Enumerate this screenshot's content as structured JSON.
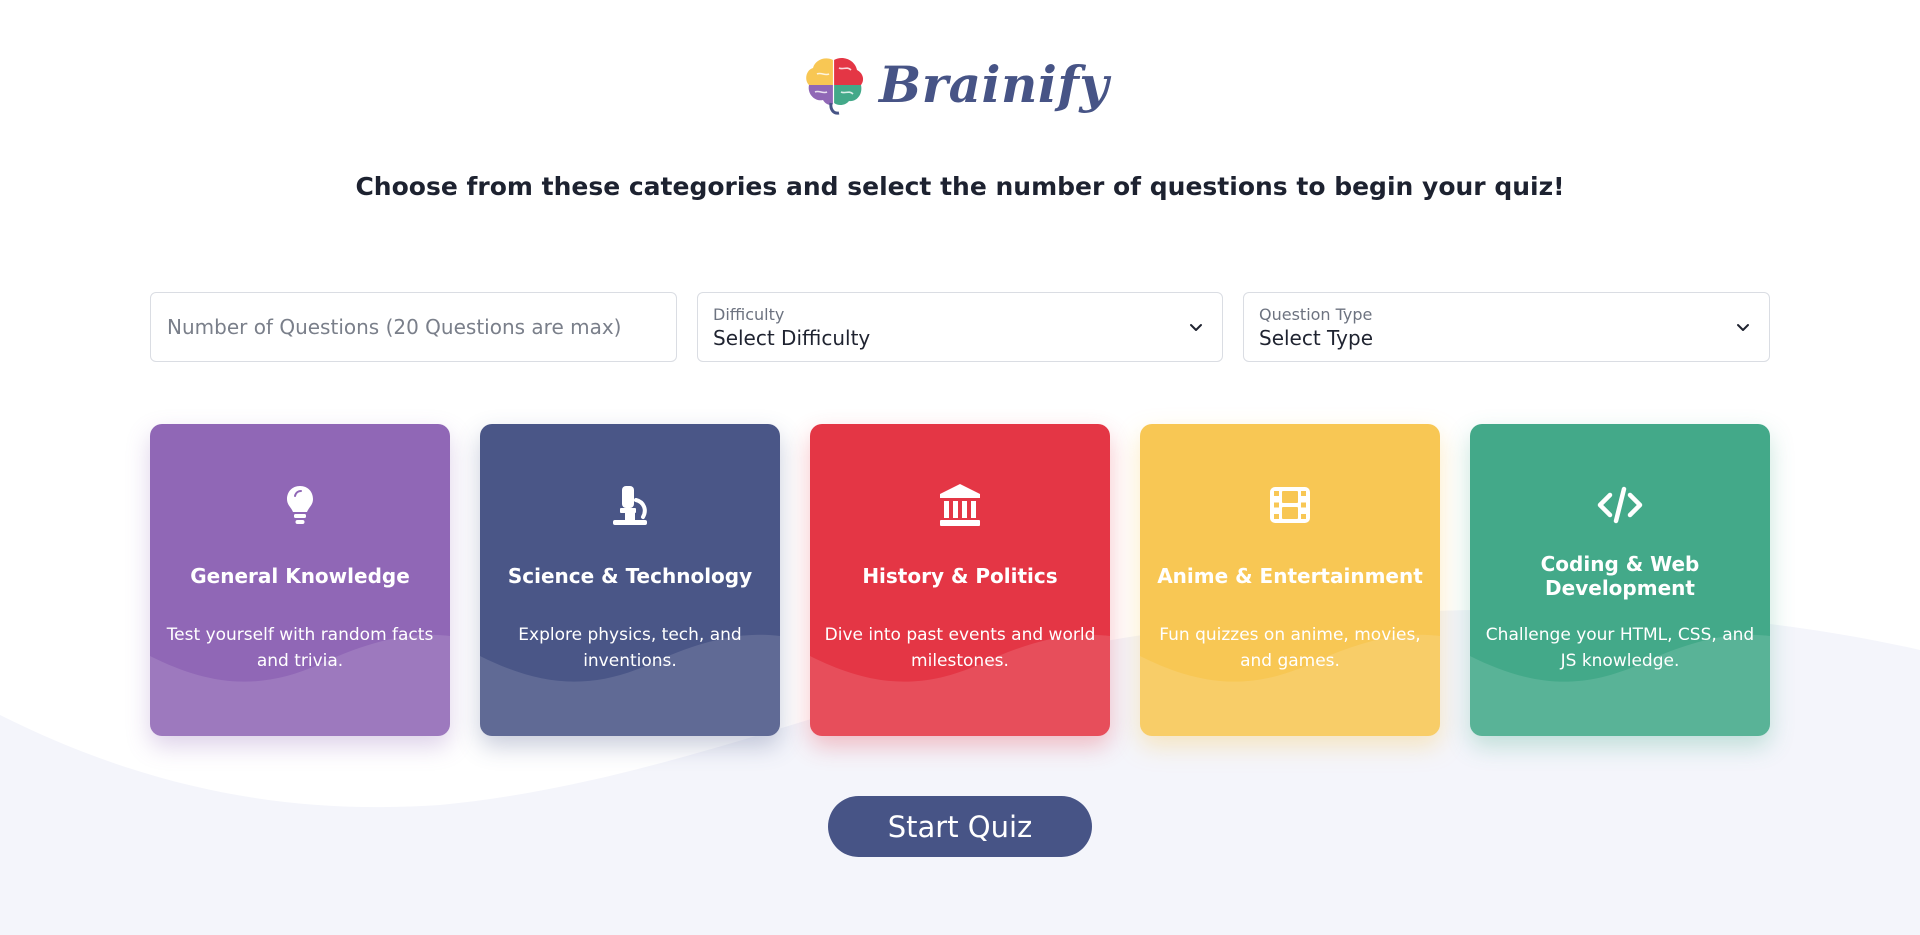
{
  "brand": {
    "name": "Brainify",
    "color": "#475486",
    "logo_icon": "brain-icon"
  },
  "subtitle": "Choose from these categories and select the number of questions to begin your quiz!",
  "form": {
    "num_questions": {
      "placeholder": "Number of Questions (20 Questions are max)",
      "value": ""
    },
    "difficulty": {
      "label": "Difficulty",
      "value": "Select Difficulty",
      "icon": "chevron-down-icon"
    },
    "question_type": {
      "label": "Question Type",
      "value": "Select Type",
      "icon": "chevron-down-icon"
    }
  },
  "categories": [
    {
      "title": "General Knowledge",
      "description": "Test yourself with random facts and trivia.",
      "icon": "lightbulb-icon",
      "color": "#9067b6"
    },
    {
      "title": "Science & Technology",
      "description": "Explore physics, tech, and inventions.",
      "icon": "microscope-icon",
      "color": "#4a5687"
    },
    {
      "title": "History & Politics",
      "description": "Dive into past events and world milestones.",
      "icon": "landmark-icon",
      "color": "#e43645"
    },
    {
      "title": "Anime & Entertainment",
      "description": "Fun quizzes on anime, movies, and games.",
      "icon": "film-icon",
      "color": "#f8c754"
    },
    {
      "title": "Coding & Web Development",
      "description": "Challenge your HTML, CSS, and JS knowledge.",
      "icon": "code-icon",
      "color": "#43a989"
    }
  ],
  "start_button": {
    "label": "Start Quiz",
    "color": "#475486"
  },
  "colors": {
    "background_wave": "#f4f5fb",
    "text_dark": "#1d2230"
  }
}
